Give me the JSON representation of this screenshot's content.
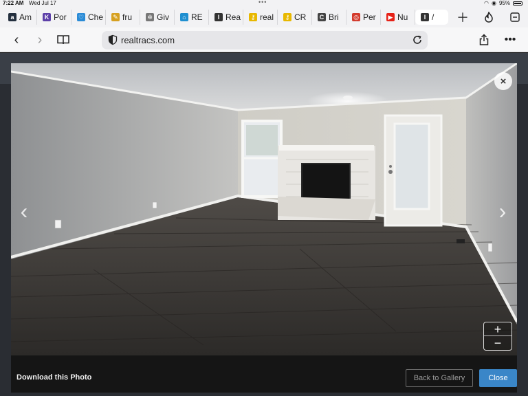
{
  "status_bar": {
    "time": "7:22 AM",
    "date": "Wed Jul 17",
    "battery": "95%"
  },
  "tabs": [
    {
      "label": "Am",
      "icon": "amazon-icon",
      "color": "#232f3e"
    },
    {
      "label": "Por",
      "icon": "portal-icon",
      "color": "#5c3fa8"
    },
    {
      "label": "Che",
      "icon": "heart-icon",
      "color": "#2a8bd6"
    },
    {
      "label": "fru",
      "icon": "pin-icon",
      "color": "#d6a020"
    },
    {
      "label": "Giv",
      "icon": "gear-icon",
      "color": "#777777"
    },
    {
      "label": "RE",
      "icon": "house-icon",
      "color": "#1f8fd0"
    },
    {
      "label": "Rea",
      "icon": "realtracs-icon",
      "color": "#333333"
    },
    {
      "label": "real",
      "icon": "key-icon",
      "color": "#e8b800"
    },
    {
      "label": "CR",
      "icon": "key-icon",
      "color": "#e8b800"
    },
    {
      "label": "Bri",
      "icon": "c-icon",
      "color": "#444444"
    },
    {
      "label": "Per",
      "icon": "lifebuoy-icon",
      "color": "#d33a2c"
    },
    {
      "label": "Nu",
      "icon": "youtube-icon",
      "color": "#e62117"
    },
    {
      "label": "/",
      "icon": "realtracs-icon",
      "color": "#333333",
      "active": true
    }
  ],
  "address_bar": {
    "url": "realtracs.com"
  },
  "lightbox": {
    "download_label": "Download this Photo",
    "back_label": "Back to Gallery",
    "close_label": "Close",
    "close_x": "×",
    "prev": "‹",
    "next": "›",
    "zoom_in": "+",
    "zoom_out": "−"
  },
  "colors": {
    "accent": "#3a86c8",
    "overlay": "#151515"
  }
}
